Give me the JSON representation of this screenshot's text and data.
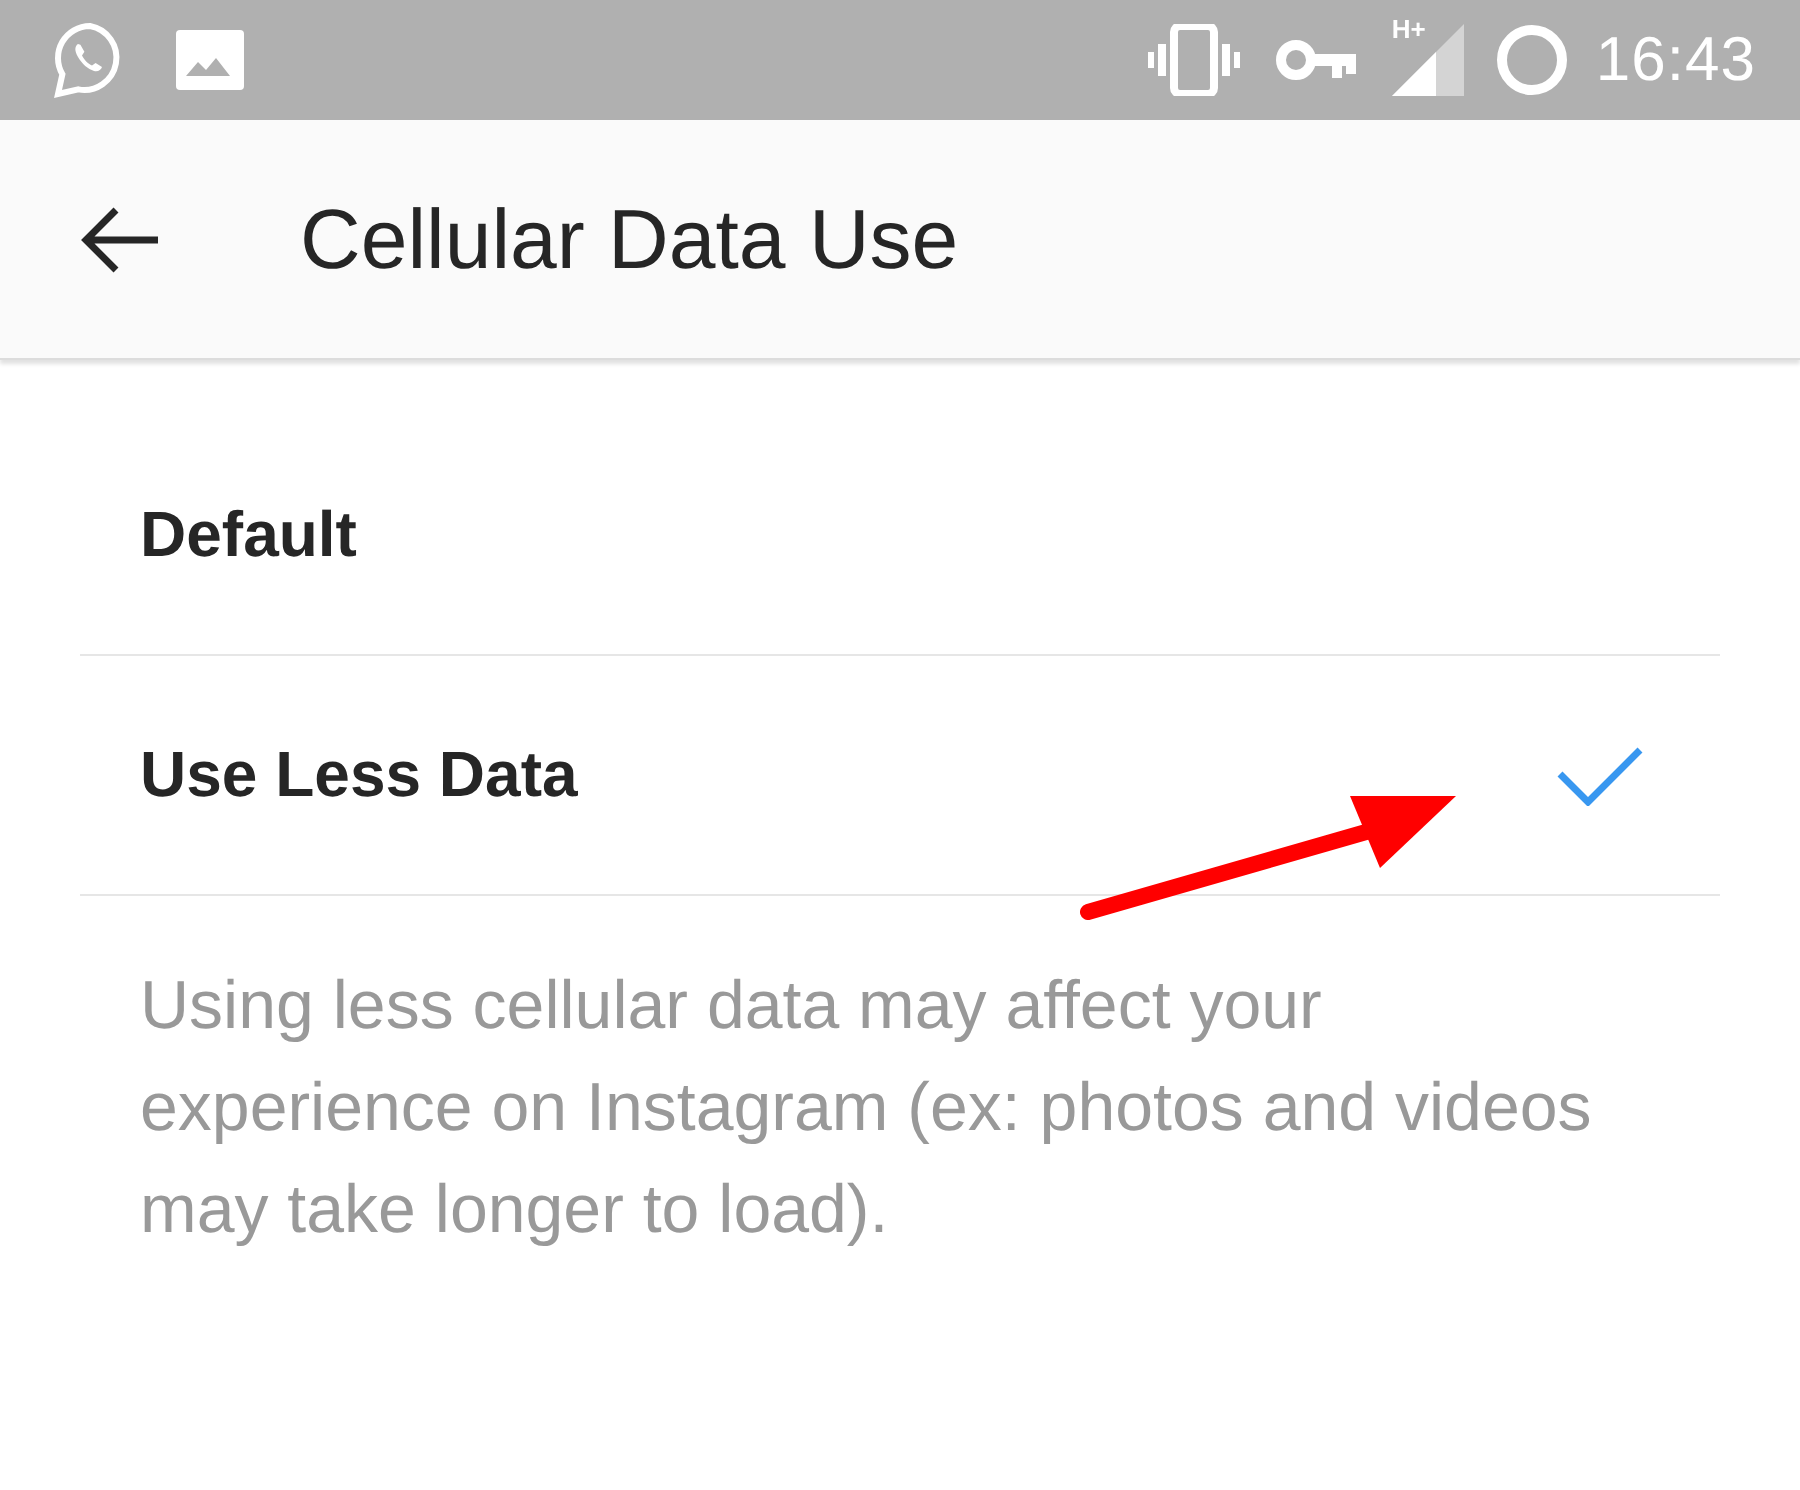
{
  "status_bar": {
    "network_type": "H+",
    "time": "16:43"
  },
  "toolbar": {
    "title": "Cellular Data Use"
  },
  "options": [
    {
      "label": "Default",
      "selected": false
    },
    {
      "label": "Use Less Data",
      "selected": true
    }
  ],
  "description": "Using less cellular data may affect your experience on Instagram (ex: photos and videos may take longer to load)."
}
